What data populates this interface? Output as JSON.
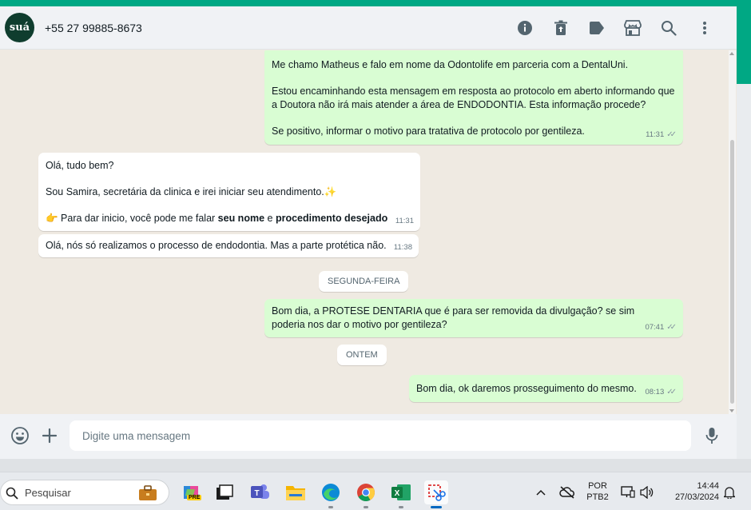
{
  "header": {
    "avatar_text": "suá",
    "contact": "+55 27 99885-8673",
    "icons": [
      "info-icon",
      "delete-icon",
      "label-icon",
      "store-icon",
      "search-icon",
      "more-icon"
    ]
  },
  "messages": [
    {
      "dir": "out",
      "text": "Me chamo Matheus e falo em nome da Odontolife em parceria com a DentalUni.\n\nEstou encaminhando esta mensagem em resposta ao protocolo em aberto informando que a Doutora não irá mais atender a área de ENDODONTIA. Esta informação procede?\n\nSe positivo, informar o motivo para tratativa de protocolo por gentileza.",
      "time": "11:31"
    },
    {
      "dir": "in",
      "text": "Olá, tudo bem?\n\nSou Samira, secretária da clinica e irei iniciar seu atendimento.",
      "sparkle": "✨",
      "line3_prefix": "👉 Para dar inicio, você pode me falar ",
      "bold1": "seu nome",
      "line3_mid": " e ",
      "bold2": "procedimento desejado",
      "time": "11:31"
    },
    {
      "dir": "in",
      "text": "Olá, nós só realizamos o processo de endodontia. Mas a parte protética não.",
      "time": "11:38"
    },
    {
      "dir": "out",
      "text": "Bom dia, a PROTESE DENTARIA que é para ser removida da divulgação? se sim poderia nos dar o motivo por gentileza?",
      "time": "07:41"
    },
    {
      "dir": "out",
      "text": "Bom dia, ok daremos prosseguimento do mesmo.",
      "time": "08:13"
    }
  ],
  "day_separators": [
    "SEGUNDA-FEIRA",
    "ONTEM"
  ],
  "composer": {
    "placeholder": "Digite uma mensagem"
  },
  "taskbar": {
    "search_placeholder": "Pesquisar",
    "lang_top": "POR",
    "lang_bottom": "PTB2",
    "time": "14:44",
    "date": "27/03/2024",
    "copilot_badge": "PRE"
  },
  "colors": {
    "accent": "#00a884",
    "outgoing": "#d9fdd3",
    "incoming": "#ffffff",
    "wallpaper": "#efeae2"
  }
}
